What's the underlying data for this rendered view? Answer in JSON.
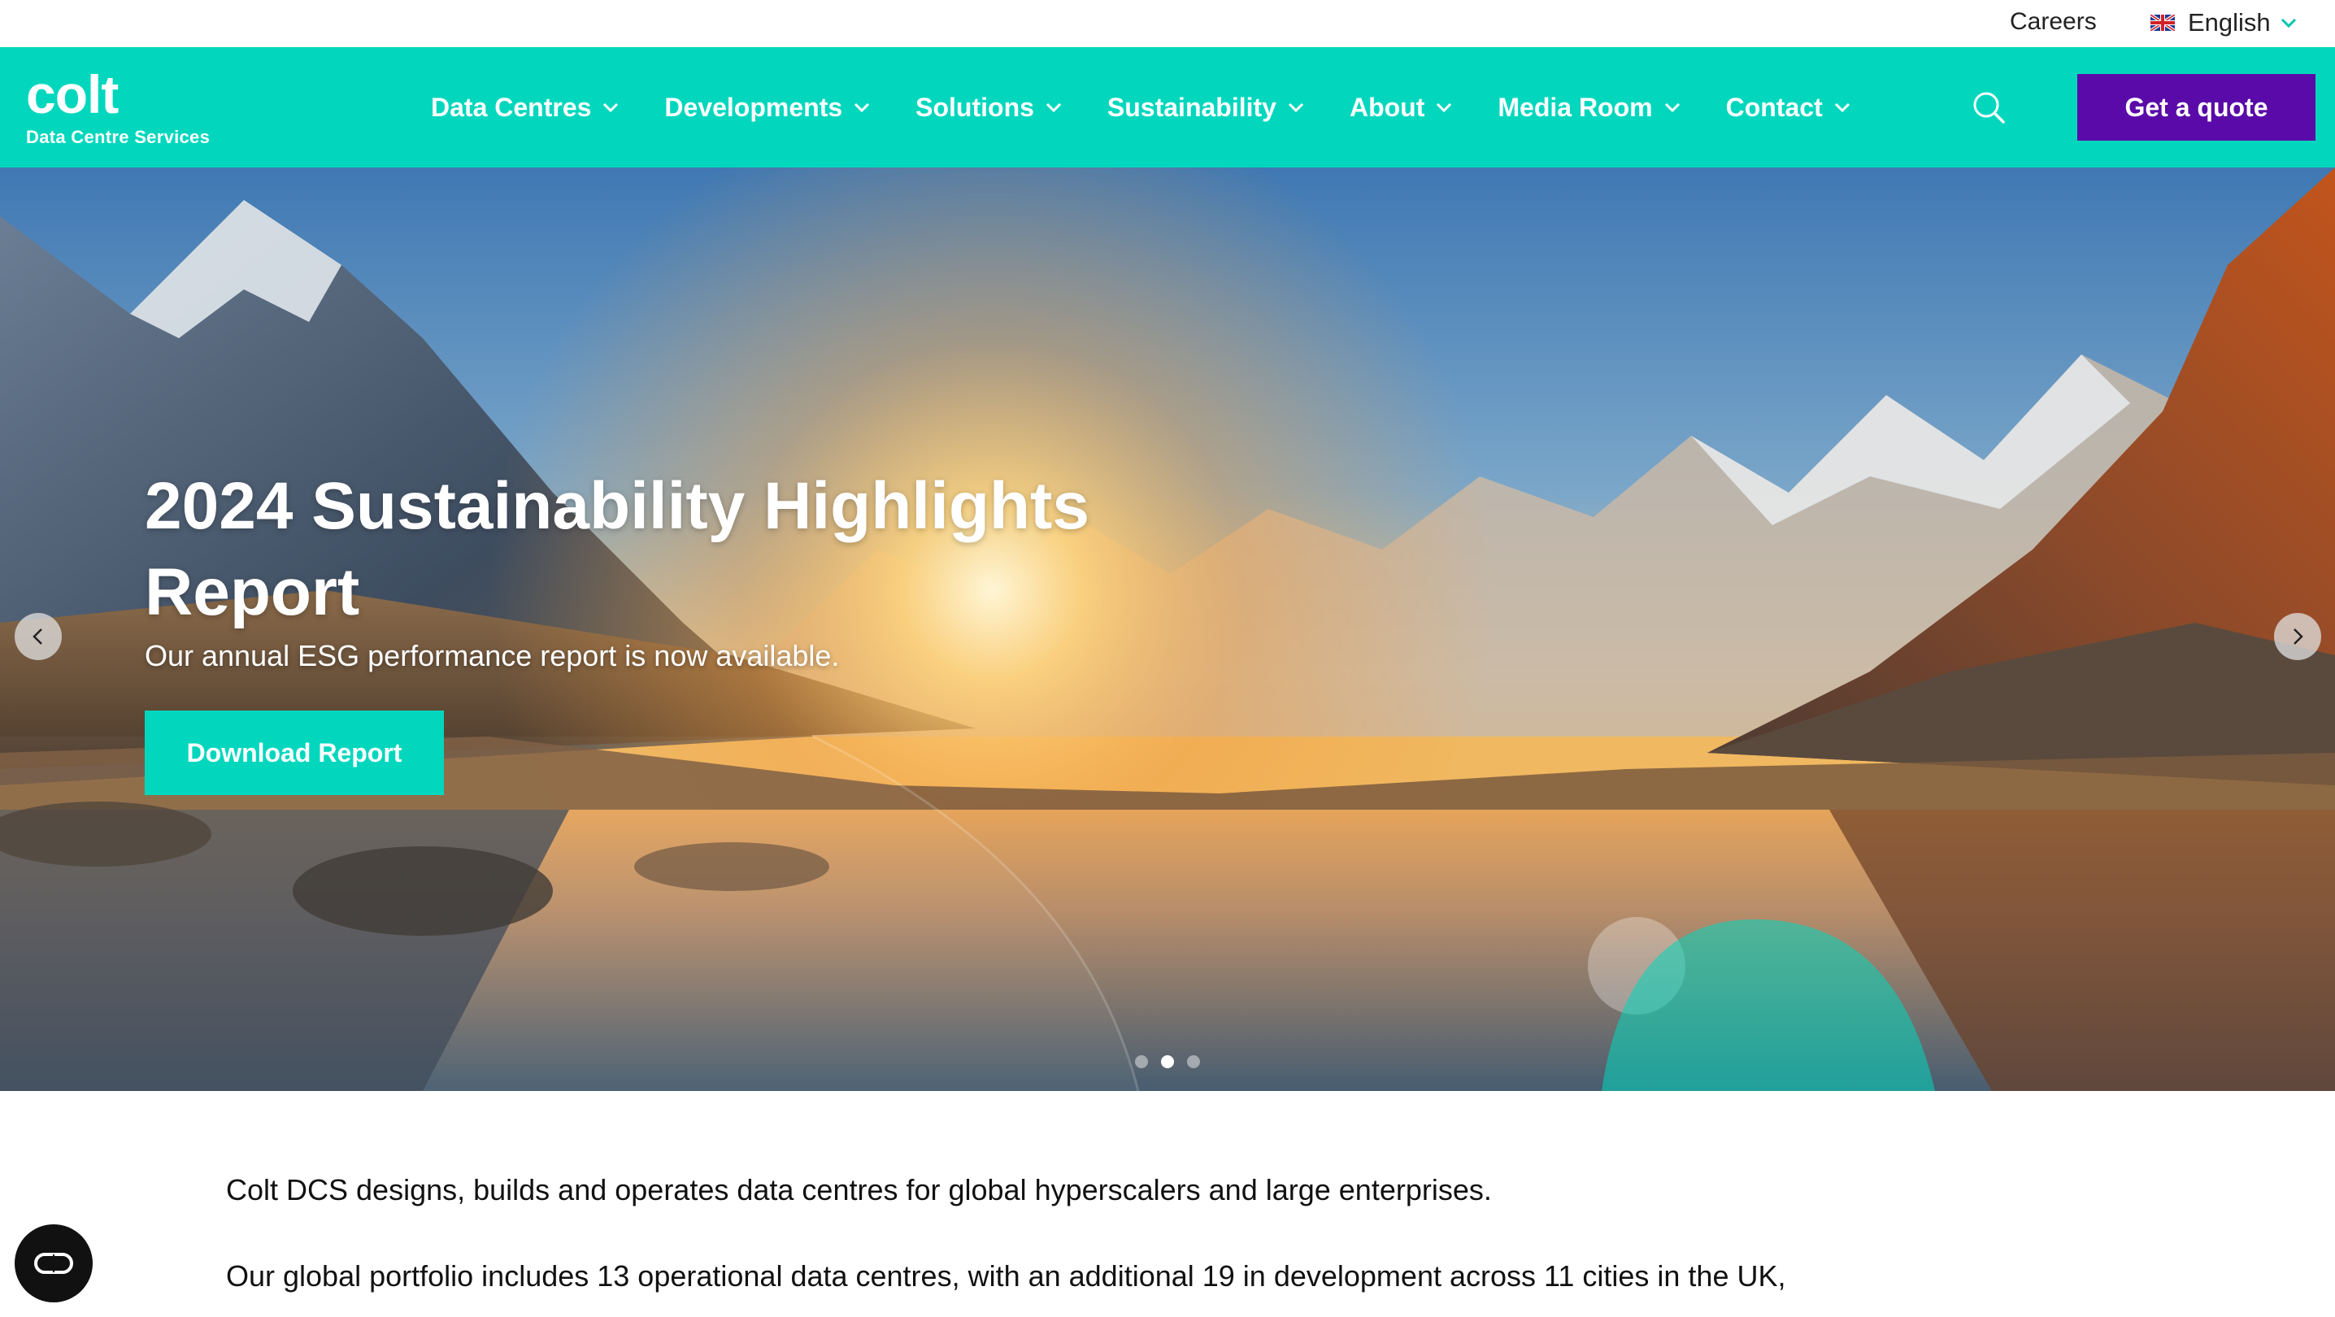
{
  "utility": {
    "careers": "Careers",
    "language": "English"
  },
  "brand": {
    "logo_word": "colt",
    "logo_sub": "Data Centre Services"
  },
  "nav": {
    "items": [
      {
        "label": "Data Centres"
      },
      {
        "label": "Developments"
      },
      {
        "label": "Solutions"
      },
      {
        "label": "Sustainability"
      },
      {
        "label": "About"
      },
      {
        "label": "Media Room"
      },
      {
        "label": "Contact"
      }
    ],
    "cta": "Get a quote"
  },
  "hero": {
    "title": "2024 Sustainability Highlights Report",
    "subtitle": "Our annual ESG performance report is now available.",
    "cta": "Download Report",
    "slide_count": 3,
    "active_slide": 2
  },
  "intro": {
    "p1": "Colt DCS designs, builds and operates data centres for global hyperscalers and large enterprises.",
    "p2": "Our global portfolio includes 13 operational data centres, with an additional 19 in development across 11 cities in the UK,"
  },
  "colors": {
    "brand_teal": "#02d7bd",
    "brand_purple": "#5a0aa8"
  },
  "icons": {
    "search": "search-icon",
    "chevron": "chevron-down-icon",
    "prev": "chevron-left-icon",
    "next": "chevron-right-icon",
    "accessibility": "accessibility-icon",
    "flag": "uk-flag-icon"
  }
}
